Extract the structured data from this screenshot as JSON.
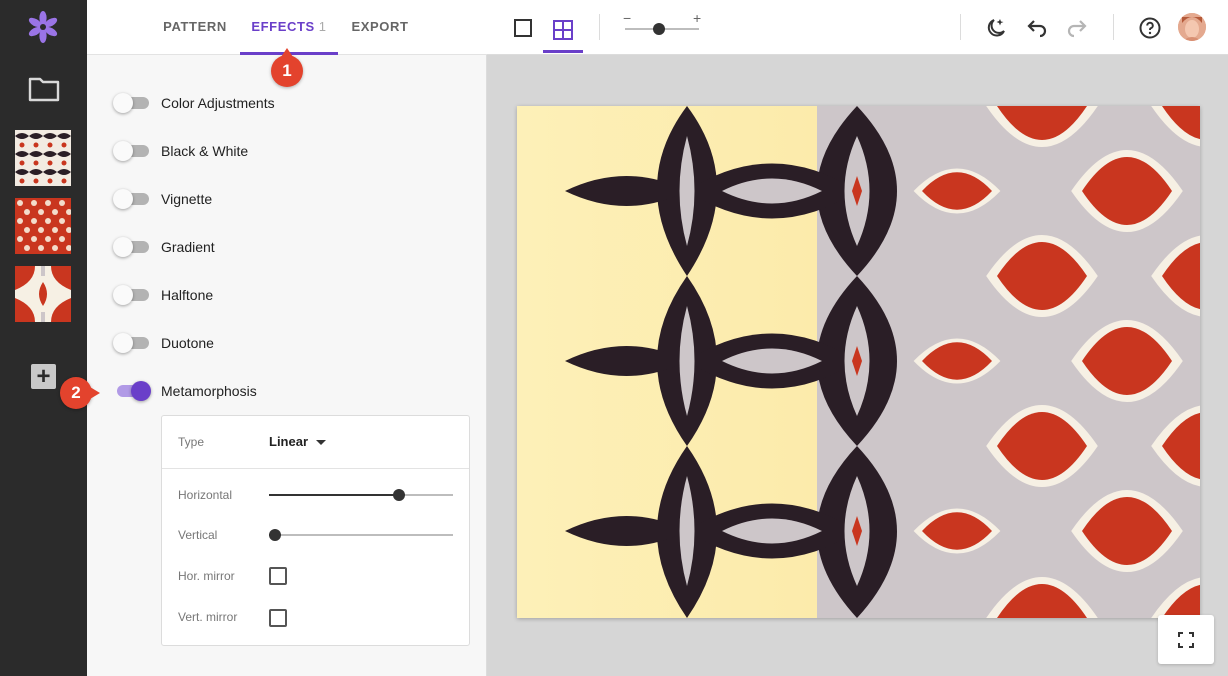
{
  "sidebar": {
    "logo_icon": "flower-logo-icon",
    "folder_icon": "folder-icon",
    "thumbnails": [
      "pattern-thumbnail-1",
      "pattern-thumbnail-2",
      "pattern-thumbnail-3"
    ],
    "add_label": "+"
  },
  "panel": {
    "tabs": [
      {
        "label": "PATTERN",
        "count": ""
      },
      {
        "label": "EFFECTS",
        "count": "1"
      },
      {
        "label": "EXPORT",
        "count": ""
      }
    ],
    "active_tab": "EFFECTS",
    "badges": [
      "1",
      "2"
    ],
    "effects": [
      {
        "label": "Color Adjustments",
        "enabled": false
      },
      {
        "label": "Black & White",
        "enabled": false
      },
      {
        "label": "Vignette",
        "enabled": false
      },
      {
        "label": "Gradient",
        "enabled": false
      },
      {
        "label": "Halftone",
        "enabled": false
      },
      {
        "label": "Duotone",
        "enabled": false
      },
      {
        "label": "Metamorphosis",
        "enabled": true
      }
    ],
    "metamorphosis": {
      "type_label": "Type",
      "type_value": "Linear",
      "horizontal_label": "Horizontal",
      "horizontal_value": 0.72,
      "vertical_label": "Vertical",
      "vertical_value": 0.0,
      "hor_mirror_label": "Hor. mirror",
      "hor_mirror_checked": false,
      "vert_mirror_label": "Vert. mirror",
      "vert_mirror_checked": false
    }
  },
  "toolbar": {
    "view_single_icon": "single-view-icon",
    "view_grid_icon": "grid-view-icon",
    "zoom_minus": "−",
    "zoom_plus": "+",
    "zoom_value": 0.45,
    "night_mode_icon": "moon-stars-icon",
    "undo_icon": "undo-icon",
    "redo_icon": "redo-icon",
    "help_icon": "help-icon",
    "avatar": "user-avatar"
  },
  "colors": {
    "accent": "#6a3fc9",
    "badge": "#e3432d",
    "rail": "#2b2b2b",
    "pattern_yellow": "#fbe9a6",
    "pattern_dark": "#2a1e26",
    "pattern_grey": "#cdc6c9",
    "pattern_red": "#c9361f",
    "pattern_cream": "#f6f0e4"
  }
}
